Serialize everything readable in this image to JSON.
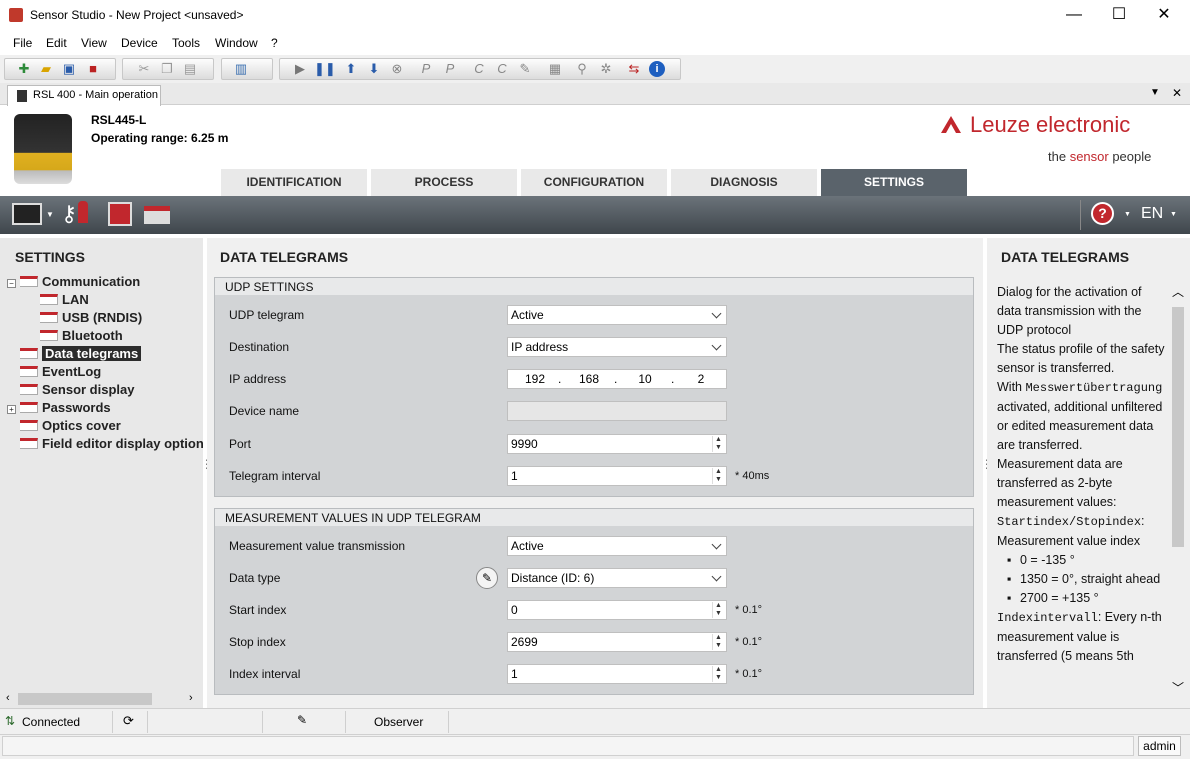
{
  "window": {
    "title": "Sensor Studio - New Project <unsaved>",
    "min": "—",
    "max": "☐",
    "close": "✕"
  },
  "menu": [
    "File",
    "Edit",
    "View",
    "Device",
    "Tools",
    "Window",
    "?"
  ],
  "doc_tab": {
    "label": "RSL 400 - Main operation"
  },
  "device": {
    "model": "RSL445-L",
    "range": "Operating range: 6.25 m"
  },
  "brand": {
    "name": "Leuze electronic",
    "tagline_pre": "the ",
    "tagline_accent": "sensor",
    "tagline_post": " people",
    "color": "#c1272d"
  },
  "nav_tabs": [
    "IDENTIFICATION",
    "PROCESS",
    "CONFIGURATION",
    "DIAGNOSIS",
    "SETTINGS"
  ],
  "active_tab": "SETTINGS",
  "lang": "EN",
  "left": {
    "title": "SETTINGS",
    "tree": [
      {
        "label": "Communication"
      },
      {
        "label": "LAN"
      },
      {
        "label": "USB (RNDIS)"
      },
      {
        "label": "Bluetooth"
      },
      {
        "label": "Data telegrams"
      },
      {
        "label": "EventLog"
      },
      {
        "label": "Sensor display"
      },
      {
        "label": "Passwords"
      },
      {
        "label": "Optics cover"
      },
      {
        "label": "Field editor display option"
      }
    ]
  },
  "main": {
    "title": "DATA TELEGRAMS",
    "udp": {
      "header": "UDP SETTINGS",
      "udp_telegram": {
        "label": "UDP telegram",
        "value": "Active"
      },
      "destination": {
        "label": "Destination",
        "value": "IP address"
      },
      "ip": {
        "label": "IP address",
        "o1": "192",
        "o2": "168",
        "o3": "10",
        "o4": "2",
        "dot": "."
      },
      "device_name": {
        "label": "Device name",
        "value": ""
      },
      "port": {
        "label": "Port",
        "value": "9990"
      },
      "interval": {
        "label": "Telegram interval",
        "value": "1",
        "unit": "* 40ms"
      }
    },
    "mv": {
      "header": "MEASUREMENT VALUES IN UDP TELEGRAM",
      "transmission": {
        "label": "Measurement value transmission",
        "value": "Active"
      },
      "data_type": {
        "label": "Data type",
        "value": "Distance (ID: 6)"
      },
      "start": {
        "label": "Start index",
        "value": "0",
        "unit": "* 0.1°"
      },
      "stop": {
        "label": "Stop index",
        "value": "2699",
        "unit": "* 0.1°"
      },
      "interval": {
        "label": "Index interval",
        "value": "1",
        "unit": "* 0.1°"
      }
    }
  },
  "right": {
    "title": "DATA TELEGRAMS",
    "p1": "Dialog for the activation of data transmission with the UDP protocol",
    "p2": "The status profile of the safety sensor is transferred.",
    "p3a": "With ",
    "p3code": "Messwertübertragung",
    "p3b": " activated, additional unfiltered or edited measurement data are transferred.",
    "p4": "Measurement data are transferred as 2-byte measurement values:",
    "p5code": "Startindex/Stopindex",
    "p5b": ": Measurement value index",
    "b1": "0 = -135 °",
    "b2": "1350 = 0°, straight ahead",
    "b3": "2700 = +135 °",
    "p6code": "Indexintervall",
    "p6b": ": Every n-th measurement value is transferred (5 means 5th"
  },
  "status": {
    "connection": "Connected",
    "mode": "Observer",
    "user": "admin"
  }
}
